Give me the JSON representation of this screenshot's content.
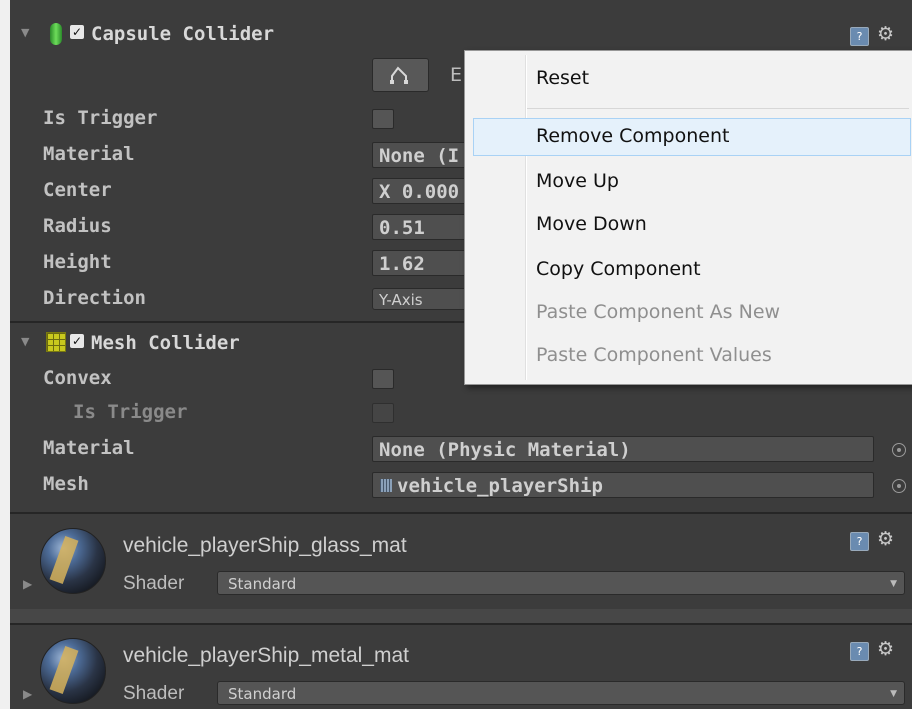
{
  "capsule": {
    "title": "Capsule Collider",
    "check": "✓",
    "edit_label": "E",
    "labels": {
      "is_trigger": "Is Trigger",
      "material": "Material",
      "center": "Center",
      "radius": "Radius",
      "height": "Height",
      "direction": "Direction"
    },
    "values": {
      "material": "None (I",
      "center": "X 0.000",
      "radius": "0.51",
      "height": "1.62",
      "direction": "Y-Axis"
    }
  },
  "mesh": {
    "title": "Mesh Collider",
    "check": "✓",
    "labels": {
      "convex": "Convex",
      "is_trigger": "Is Trigger",
      "material": "Material",
      "mesh": "Mesh"
    },
    "values": {
      "material": "None (Physic Material)",
      "mesh": "vehicle_playerShip"
    }
  },
  "materials": [
    {
      "name": "vehicle_playerShip_glass_mat",
      "shader_label": "Shader",
      "shader": "Standard"
    },
    {
      "name": "vehicle_playerShip_metal_mat",
      "shader_label": "Shader",
      "shader": "Standard"
    }
  ],
  "help_glyph": "?",
  "gear_glyph": "⚙",
  "context_menu": {
    "items": [
      {
        "label": "Reset",
        "enabled": true
      },
      {
        "label": "Remove Component",
        "enabled": true,
        "highlighted": true
      },
      {
        "label": "Move Up",
        "enabled": true
      },
      {
        "label": "Move Down",
        "enabled": true
      },
      {
        "label": "Copy Component",
        "enabled": true
      },
      {
        "label": "Paste Component As New",
        "enabled": false
      },
      {
        "label": "Paste Component Values",
        "enabled": false
      }
    ]
  },
  "icons": {
    "capsule": "capsule-collider-icon",
    "mesh": "mesh-collider-icon",
    "edit": "edit-collider-icon",
    "help": "help-icon",
    "gear": "gear-icon",
    "picker": "object-picker-icon",
    "foldout": "foldout-arrow-icon",
    "material": "material-preview-icon",
    "mesh_asset": "mesh-asset-icon"
  },
  "colors": {
    "panel": "#3c3c3c",
    "menu_bg": "#f2f2f2",
    "menu_highlight": "#e5f1fb",
    "capsule_icon": "#3fb43f",
    "mesh_icon": "#c8c81e"
  }
}
